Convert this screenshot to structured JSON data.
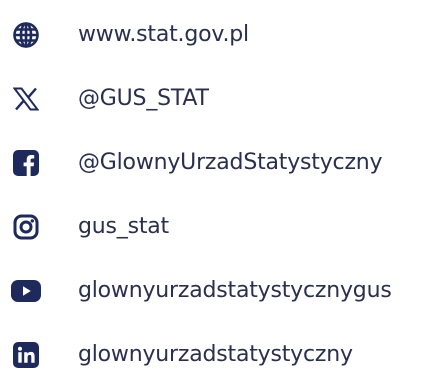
{
  "colors": {
    "icon": "#1f2a5c",
    "text": "#2a2f4d",
    "background": "#ffffff"
  },
  "contacts": [
    {
      "icon": "globe-icon",
      "label": "www.stat.gov.pl"
    },
    {
      "icon": "x-logo-icon",
      "label": "@GUS_STAT"
    },
    {
      "icon": "facebook-icon",
      "label": "@GlownyUrzadStatystyczny"
    },
    {
      "icon": "instagram-icon",
      "label": "gus_stat"
    },
    {
      "icon": "youtube-icon",
      "label": "glownyurzadstatystycznygus"
    },
    {
      "icon": "linkedin-icon",
      "label": "glownyurzadstatystyczny"
    }
  ]
}
